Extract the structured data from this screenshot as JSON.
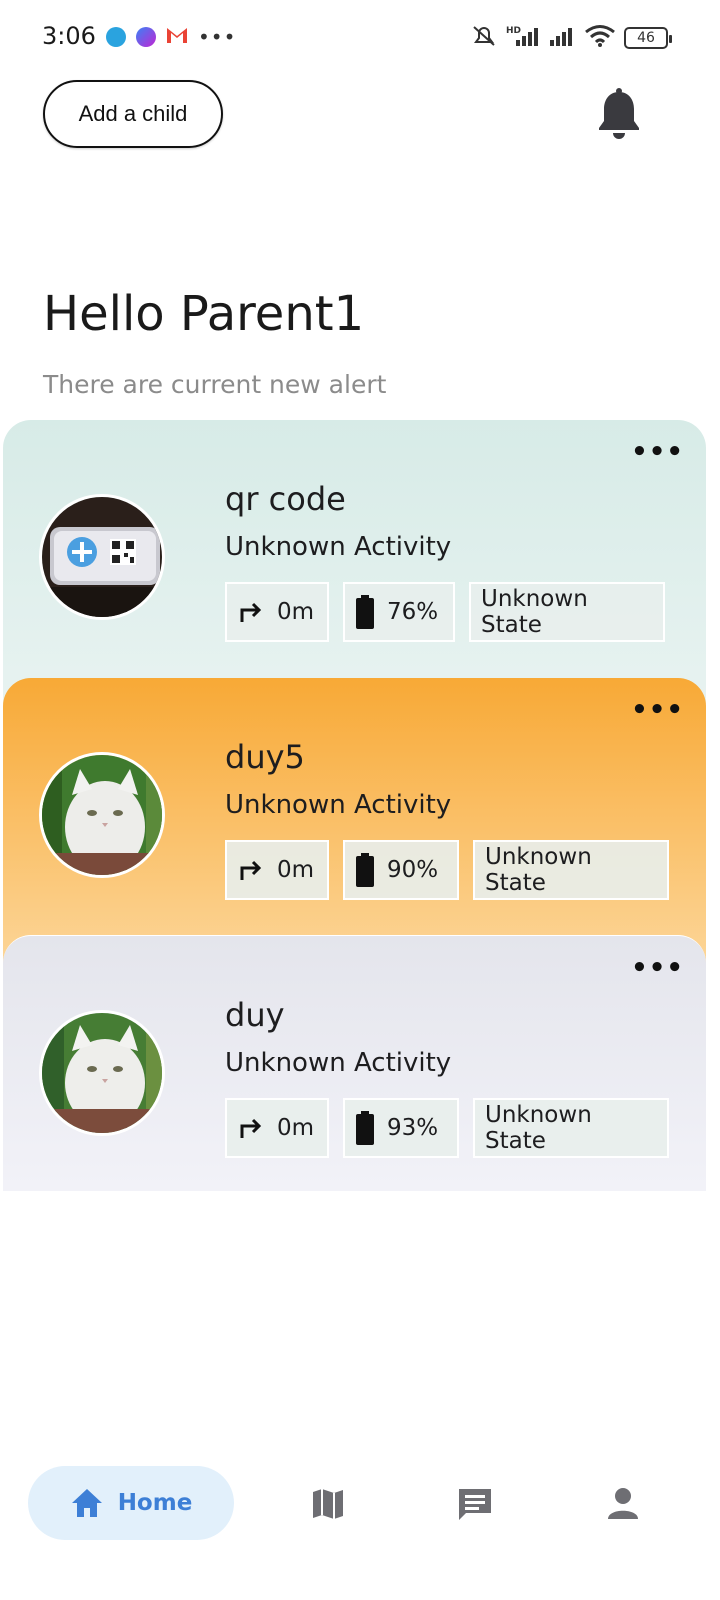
{
  "status_bar": {
    "time": "3:06",
    "battery_level": "46",
    "app_icons": [
      "telegram-icon",
      "messenger-icon",
      "gmail-icon"
    ],
    "system_icons": [
      "mute-icon",
      "hd-signal-icon",
      "signal-icon",
      "wifi-icon",
      "battery-icon"
    ]
  },
  "header": {
    "add_child_label": "Add a child",
    "bell_icon": "bell-icon"
  },
  "greeting": {
    "title": "Hello Parent1",
    "subtitle": "There are current new alert"
  },
  "children": [
    {
      "name": "qr code",
      "activity": "Unknown Activity",
      "distance": "0m",
      "battery": "76%",
      "state": "Unknown State",
      "accent": "#d7ebe7"
    },
    {
      "name": "duy5",
      "activity": "Unknown Activity",
      "distance": "0m",
      "battery": "90%",
      "state": "Unknown State",
      "accent": "#f8a936"
    },
    {
      "name": "duy",
      "activity": "Unknown Activity",
      "distance": "0m",
      "battery": "93%",
      "state": "Unknown State",
      "accent": "#e4e5ec"
    }
  ],
  "bottom_nav": {
    "home_label": "Home",
    "active_color": "#3d7fd6",
    "items": [
      "home-icon",
      "map-icon",
      "chat-icon",
      "profile-icon"
    ]
  }
}
